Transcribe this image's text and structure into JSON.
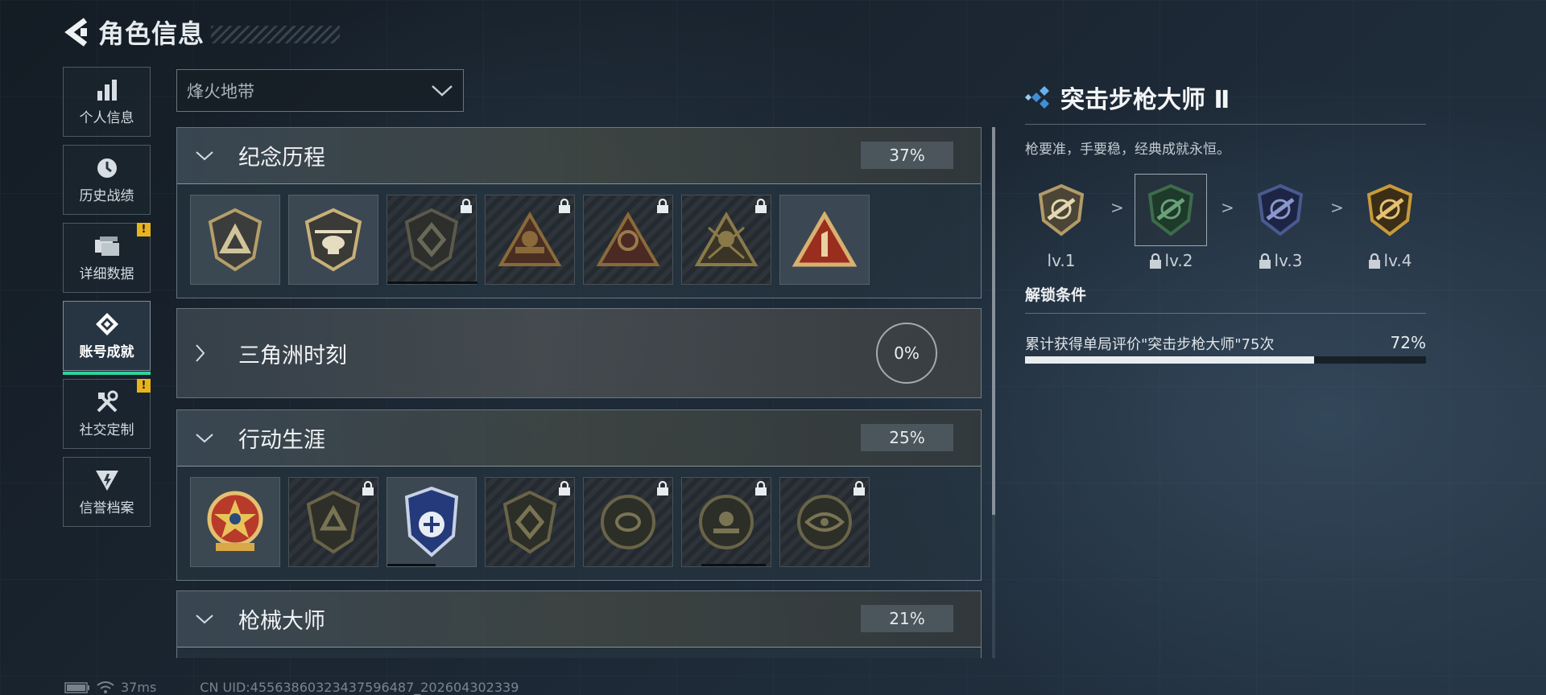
{
  "header": {
    "title": "角色信息"
  },
  "sidebar": {
    "items": [
      {
        "label": "个人信息",
        "icon": "bar-chart-icon",
        "active": false,
        "alert": false
      },
      {
        "label": "历史战绩",
        "icon": "clock-icon",
        "active": false,
        "alert": false
      },
      {
        "label": "详细数据",
        "icon": "folder-icon",
        "active": false,
        "alert": true
      },
      {
        "label": "账号成就",
        "icon": "achievement-icon",
        "active": true,
        "alert": false
      },
      {
        "label": "社交定制",
        "icon": "tools-icon",
        "active": false,
        "alert": true
      },
      {
        "label": "信誉档案",
        "icon": "reputation-icon",
        "active": false,
        "alert": false
      }
    ],
    "alert_mark": "!"
  },
  "season_select": {
    "value": "烽火地带"
  },
  "categories": [
    {
      "name": "纪念历程",
      "progress_text": "37%",
      "expanded": true
    },
    {
      "name": "三角洲时刻",
      "progress_text": "0%",
      "expanded": false
    },
    {
      "name": "行动生涯",
      "progress_text": "25%",
      "expanded": true
    },
    {
      "name": "枪械大师",
      "progress_text": "21%",
      "expanded": true
    }
  ],
  "detail": {
    "title": "突击步枪大师 Ⅱ",
    "description": "枪要准，手要稳，经典成就永恒。",
    "levels": [
      {
        "label": "lv.1",
        "locked": false,
        "color": "#b39a6a"
      },
      {
        "label": "lv.2",
        "locked": true,
        "color": "#3d6b4c"
      },
      {
        "label": "lv.3",
        "locked": true,
        "color": "#4a5a8f"
      },
      {
        "label": "lv.4",
        "locked": true,
        "color": "#c79a3a"
      }
    ],
    "level_arrow": ">",
    "unlock_title": "解锁条件",
    "condition": {
      "text": "累计获得单局评价\"突击步枪大师\"75次",
      "progress_text": "72%",
      "progress": 0.72
    }
  },
  "status_bar": {
    "ping": "37ms",
    "uid": "CN UID:45563860323437596487_202604302339"
  },
  "colors": {
    "accent_green": "#2fd49d",
    "alert_yellow": "#e8b41e",
    "detail_icon": "#3f8fd8"
  }
}
